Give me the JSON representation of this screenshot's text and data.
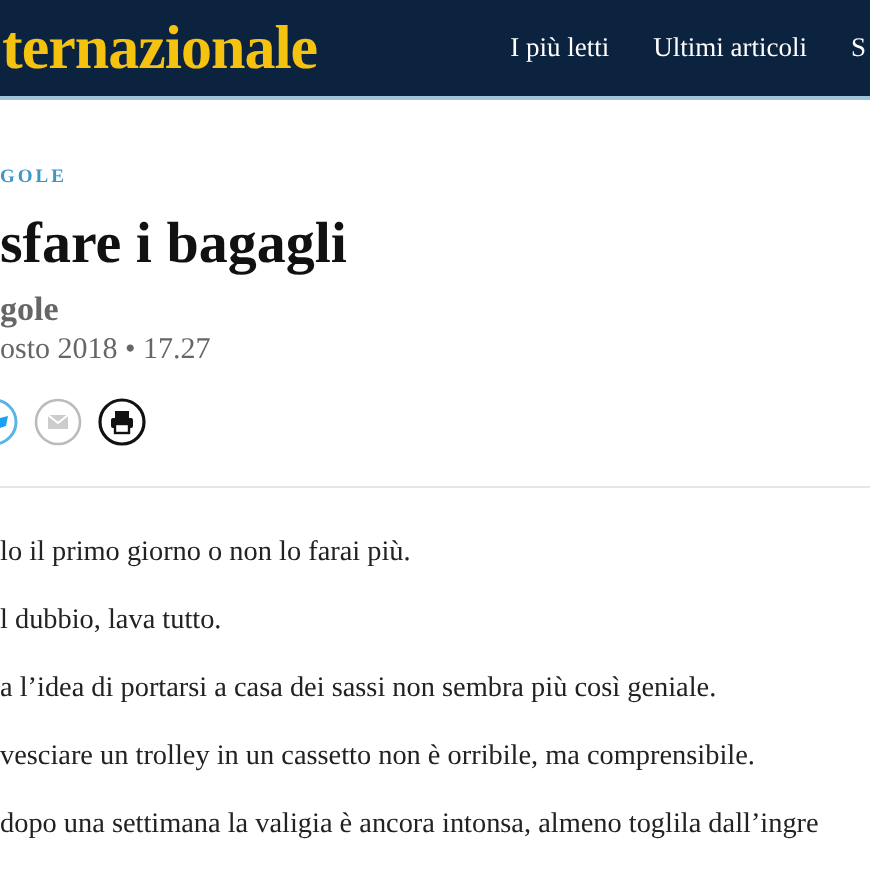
{
  "header": {
    "logo": "ternazionale",
    "nav": [
      "I più letti",
      "Ultimi articoli",
      "S"
    ]
  },
  "article": {
    "category": "GOLE",
    "title": "sfare i bagagli",
    "author": "gole",
    "date": "osto 2018 • 17.27",
    "paragraphs": [
      "lo il primo giorno o non lo farai più.",
      "l dubbio, lava tutto.",
      "a l’idea di portarsi a casa dei sassi non sembra più così geniale.",
      "vesciare un trolley in un cassetto non è orribile, ma comprensibile.",
      "dopo una settimana la valigia è ancora intonsa, almeno toglila dall’ingre"
    ]
  }
}
